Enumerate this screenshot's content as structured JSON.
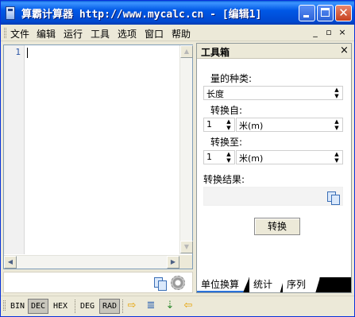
{
  "window": {
    "title": "算霸计算器 http://www.mycalc.cn - [编辑1]",
    "accent": "#0054e3",
    "close_color": "#c7401f"
  },
  "menu": {
    "items": [
      "文件",
      "编辑",
      "运行",
      "工具",
      "选项",
      "窗口",
      "帮助"
    ],
    "mdi_controls": [
      "_",
      "▫",
      "×"
    ]
  },
  "editor": {
    "line_numbers": [
      "1"
    ],
    "content": ""
  },
  "toolbox": {
    "title": "工具箱",
    "close": "×",
    "quantity_label": "量的种类:",
    "quantity_value": "长度",
    "from_label": "转换自:",
    "from_number": "1",
    "from_unit": "米(m)",
    "to_label": "转换至:",
    "to_number": "1",
    "to_unit": "米(m)",
    "result_label": "转换结果:",
    "result_value": "",
    "convert_button": "转换",
    "tabs": [
      "单位换算",
      "统计",
      "序列"
    ],
    "active_tab": "单位换算"
  },
  "bottombar": {
    "bases": [
      "BIN",
      "DEC",
      "HEX"
    ],
    "active_base": "DEC",
    "angles": [
      "DEG",
      "RAD"
    ],
    "active_angle": "RAD",
    "icons": [
      "run-arrow-icon",
      "step-icon",
      "step-into-icon",
      "stop-arrow-icon"
    ]
  }
}
